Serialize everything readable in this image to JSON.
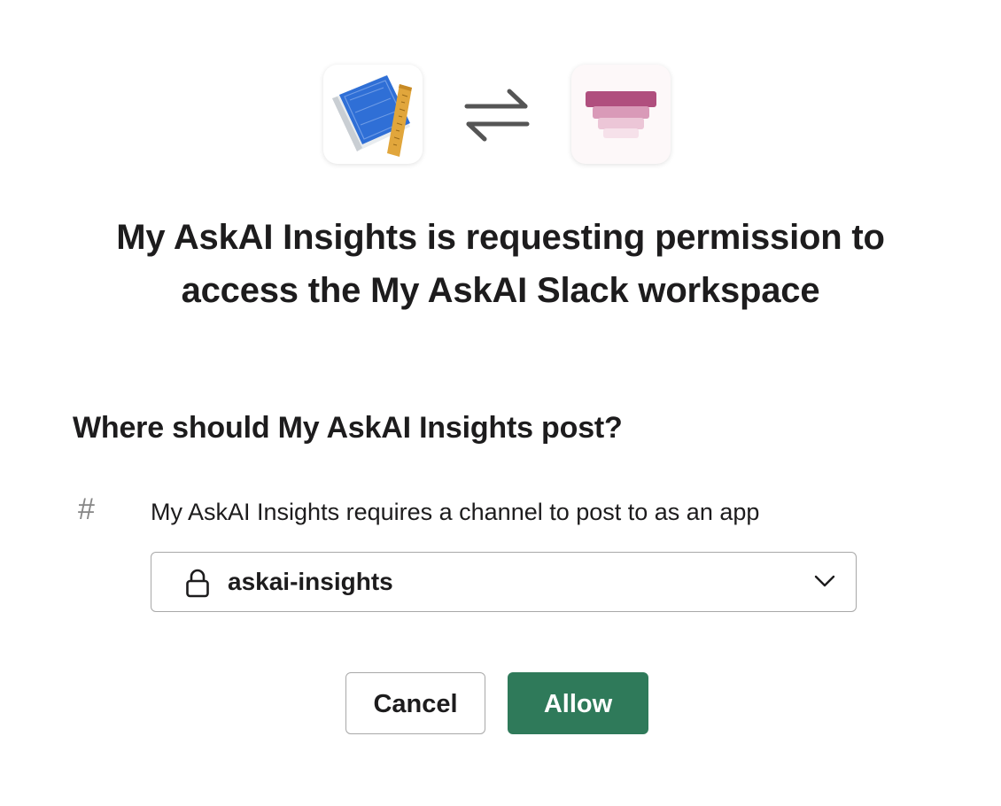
{
  "header": {
    "source_app_icon": "blueprint-ruler-icon",
    "exchange_icon": "exchange-arrows-icon",
    "target_app_icon": "layered-stack-icon"
  },
  "title": {
    "line1": "My AskAI Insights is requesting permission to",
    "line2": "access the My AskAI Slack workspace"
  },
  "post_section": {
    "question": "Where should My AskAI Insights post?",
    "hash_icon_glyph": "#",
    "requirement_text": "My AskAI Insights requires a channel to post to as an app",
    "channel_select": {
      "lock_icon": "lock-icon",
      "selected_value": "askai-insights",
      "chevron_icon": "chevron-down-icon"
    }
  },
  "actions": {
    "cancel_label": "Cancel",
    "allow_label": "Allow"
  },
  "colors": {
    "allow_button": "#2f7a5a",
    "target_app_accent": "#b04f7e",
    "source_app_blue": "#2f6fd6",
    "ruler": "#e1a63c"
  }
}
